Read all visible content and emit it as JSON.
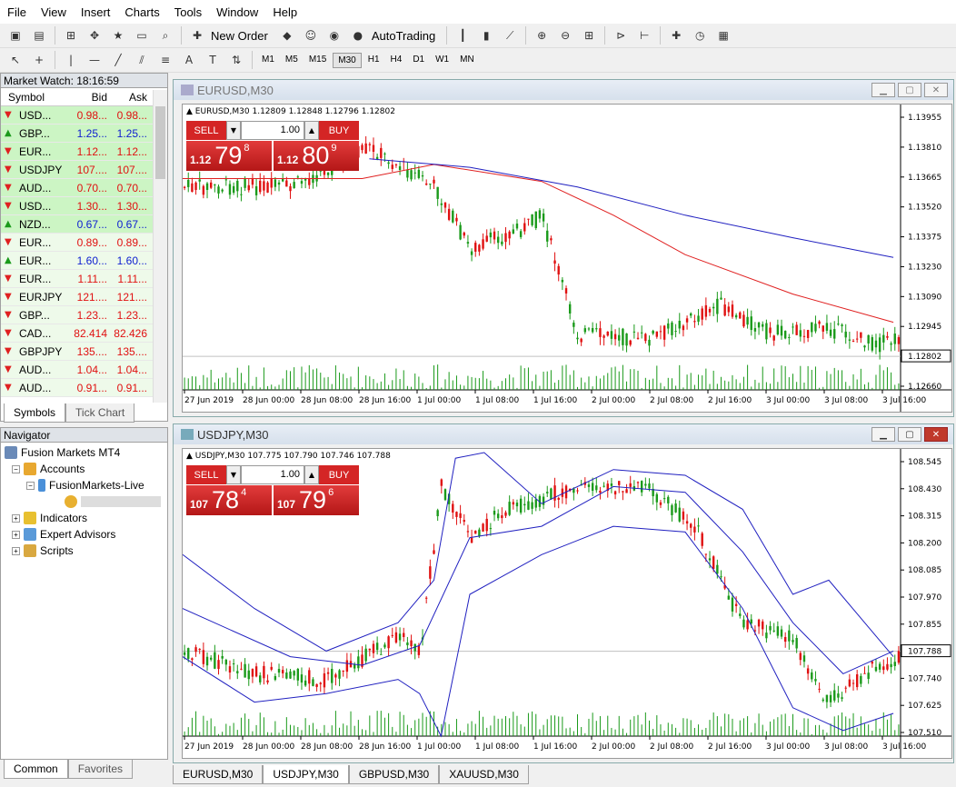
{
  "menu": [
    "File",
    "View",
    "Insert",
    "Charts",
    "Tools",
    "Window",
    "Help"
  ],
  "toolbar": {
    "new_order": "New Order",
    "autotrading": "AutoTrading"
  },
  "timeframes": [
    "M1",
    "M5",
    "M15",
    "M30",
    "H1",
    "H4",
    "D1",
    "W1",
    "MN"
  ],
  "timeframe_selected": "M30",
  "market_watch": {
    "title": "Market Watch: 18:16:59",
    "headers": [
      "Symbol",
      "Bid",
      "Ask"
    ],
    "rows": [
      {
        "dir": "down",
        "sym": "USD...",
        "bid": "0.98...",
        "ask": "0.98...",
        "color": "red",
        "hl": true
      },
      {
        "dir": "up",
        "sym": "GBP...",
        "bid": "1.25...",
        "ask": "1.25...",
        "color": "blue",
        "hl": true
      },
      {
        "dir": "down",
        "sym": "EUR...",
        "bid": "1.12...",
        "ask": "1.12...",
        "color": "red",
        "hl": true
      },
      {
        "dir": "down",
        "sym": "USDJPY",
        "bid": "107....",
        "ask": "107....",
        "color": "red",
        "hl": true
      },
      {
        "dir": "down",
        "sym": "AUD...",
        "bid": "0.70...",
        "ask": "0.70...",
        "color": "red",
        "hl": true
      },
      {
        "dir": "down",
        "sym": "USD...",
        "bid": "1.30...",
        "ask": "1.30...",
        "color": "red",
        "hl": true
      },
      {
        "dir": "up",
        "sym": "NZD...",
        "bid": "0.67...",
        "ask": "0.67...",
        "color": "blue",
        "hl": true
      },
      {
        "dir": "down",
        "sym": "EUR...",
        "bid": "0.89...",
        "ask": "0.89...",
        "color": "red",
        "hl": false
      },
      {
        "dir": "up",
        "sym": "EUR...",
        "bid": "1.60...",
        "ask": "1.60...",
        "color": "blue",
        "hl": false
      },
      {
        "dir": "down",
        "sym": "EUR...",
        "bid": "1.11...",
        "ask": "1.11...",
        "color": "red",
        "hl": false
      },
      {
        "dir": "down",
        "sym": "EURJPY",
        "bid": "121....",
        "ask": "121....",
        "color": "red",
        "hl": false
      },
      {
        "dir": "down",
        "sym": "GBP...",
        "bid": "1.23...",
        "ask": "1.23...",
        "color": "red",
        "hl": false
      },
      {
        "dir": "down",
        "sym": "CAD...",
        "bid": "82.414",
        "ask": "82.426",
        "color": "red",
        "hl": false
      },
      {
        "dir": "down",
        "sym": "GBPJPY",
        "bid": "135....",
        "ask": "135....",
        "color": "red",
        "hl": false
      },
      {
        "dir": "down",
        "sym": "AUD...",
        "bid": "1.04...",
        "ask": "1.04...",
        "color": "red",
        "hl": false
      },
      {
        "dir": "down",
        "sym": "AUD...",
        "bid": "0.91...",
        "ask": "0.91...",
        "color": "red",
        "hl": false
      }
    ],
    "tabs": [
      "Symbols",
      "Tick Chart"
    ]
  },
  "navigator": {
    "title": "Navigator",
    "root": "Fusion Markets MT4",
    "accounts": "Accounts",
    "server": "FusionMarkets-Live",
    "indicators": "Indicators",
    "experts": "Expert Advisors",
    "scripts": "Scripts",
    "tabs": [
      "Common",
      "Favorites"
    ]
  },
  "chart1": {
    "window_title": "EURUSD,M30",
    "info": "EURUSD,M30  1.12809 1.12848 1.12796 1.12802",
    "lot": "1.00",
    "sell": "SELL",
    "buy": "BUY",
    "sell_pre": "1.12",
    "sell_big": "79",
    "sell_sup": "8",
    "buy_pre": "1.12",
    "buy_big": "80",
    "buy_sup": "9",
    "y_ticks": [
      "1.13955",
      "1.13810",
      "1.13665",
      "1.13520",
      "1.13375",
      "1.13230",
      "1.13090",
      "1.12945",
      "1.12802",
      "1.12660"
    ],
    "current": "1.12802",
    "x_ticks": [
      "27 Jun 2019",
      "28 Jun 00:00",
      "28 Jun 08:00",
      "28 Jun 16:00",
      "1 Jul 00:00",
      "1 Jul 08:00",
      "1 Jul 16:00",
      "2 Jul 00:00",
      "2 Jul 08:00",
      "2 Jul 16:00",
      "3 Jul 00:00",
      "3 Jul 08:00",
      "3 Jul 16:00"
    ]
  },
  "chart2": {
    "window_title": "USDJPY,M30",
    "info": "USDJPY,M30  107.775 107.790 107.746 107.788",
    "lot": "1.00",
    "sell": "SELL",
    "buy": "BUY",
    "sell_pre": "107",
    "sell_big": "78",
    "sell_sup": "4",
    "buy_pre": "107",
    "buy_big": "79",
    "buy_sup": "6",
    "y_ticks": [
      "108.545",
      "108.430",
      "108.315",
      "108.200",
      "108.085",
      "107.970",
      "107.855",
      "107.788",
      "107.740",
      "107.625",
      "107.510"
    ],
    "current": "107.788",
    "x_ticks": [
      "27 Jun 2019",
      "28 Jun 00:00",
      "28 Jun 08:00",
      "28 Jun 16:00",
      "1 Jul 00:00",
      "1 Jul 08:00",
      "1 Jul 16:00",
      "2 Jul 00:00",
      "2 Jul 08:00",
      "2 Jul 16:00",
      "3 Jul 00:00",
      "3 Jul 08:00",
      "3 Jul 16:00"
    ]
  },
  "chart_tabs": [
    "EURUSD,M30",
    "USDJPY,M30",
    "GBPUSD,M30",
    "XAUUSD,M30"
  ],
  "chart_tab_selected": "USDJPY,M30",
  "colors": {
    "bull": "#1a9a1a",
    "bear": "#e01010",
    "ma_fast": "#e02020",
    "ma_slow": "#2020c0",
    "bands": "#2020c0"
  }
}
